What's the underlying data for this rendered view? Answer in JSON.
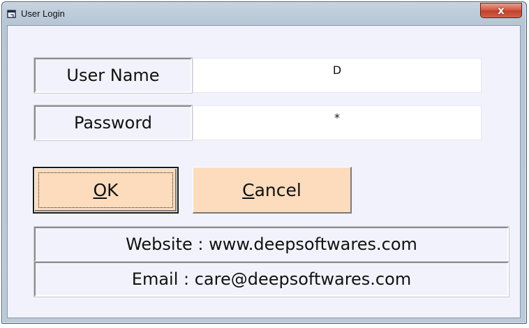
{
  "window": {
    "title": "User Login",
    "close_symbol": "x"
  },
  "form": {
    "username_label": "User Name",
    "username_value": "D",
    "password_label": "Password",
    "password_value": "*"
  },
  "buttons": {
    "ok_accel": "O",
    "ok_rest": "K",
    "cancel_accel": "C",
    "cancel_rest": "ancel"
  },
  "info": {
    "website": "Website : www.deepsoftwares.com",
    "email": "Email : care@deepsoftwares.com"
  },
  "icons": {
    "app": "app-window-icon",
    "close": "close-icon"
  },
  "colors": {
    "button_fill": "#fddcbe",
    "client_bg": "#f2f2fc",
    "close_button": "#c2412b"
  }
}
